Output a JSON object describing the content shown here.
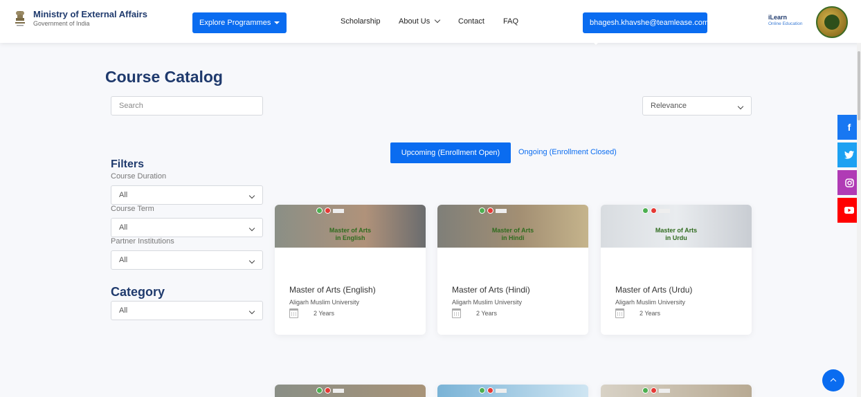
{
  "header": {
    "brand_title": "Ministry of External Affairs",
    "brand_sub": "Government of India",
    "explore_label": "Explore Programmes",
    "nav": {
      "scholarship": "Scholarship",
      "about": "About Us",
      "contact": "Contact",
      "faq": "FAQ"
    },
    "user_email": "bhagesh.khavshe@teamlease.com",
    "ilearn_title": "iLearn",
    "ilearn_sub": "Online Education"
  },
  "page": {
    "title": "Course Catalog",
    "search_placeholder": "Search",
    "sort_value": "Relevance"
  },
  "tabs": {
    "upcoming": "Upcoming (Enrollment Open)",
    "ongoing": "Ongoing (Enrollment Closed)"
  },
  "filters": {
    "heading": "Filters",
    "duration_label": "Course Duration",
    "duration_value": "All",
    "term_label": "Course Term",
    "term_value": "All",
    "partner_label": "Partner Institutions",
    "partner_value": "All",
    "category_heading": "Category",
    "category_value": "All"
  },
  "courses": [
    {
      "img_title_1": "Master of Arts",
      "img_title_2": "in English",
      "name": "Master of Arts (English)",
      "university": "Aligarh Muslim University",
      "duration": "2 Years"
    },
    {
      "img_title_1": "Master of Arts",
      "img_title_2": "in Hindi",
      "name": "Master of Arts (Hindi)",
      "university": "Aligarh Muslim University",
      "duration": "2 Years"
    },
    {
      "img_title_1": "Master of Arts",
      "img_title_2": "in Urdu",
      "name": "Master of Arts (Urdu)",
      "university": "Aligarh Muslim University",
      "duration": "2 Years"
    }
  ],
  "social": [
    "facebook-icon",
    "twitter-icon",
    "instagram-icon",
    "youtube-icon"
  ],
  "colors": {
    "primary": "#0a6cf0",
    "heading": "#1f3a6d",
    "facebook": "#1877f2",
    "twitter": "#1da1f2",
    "instagram": "#b03bb5",
    "youtube": "#ff0000"
  }
}
